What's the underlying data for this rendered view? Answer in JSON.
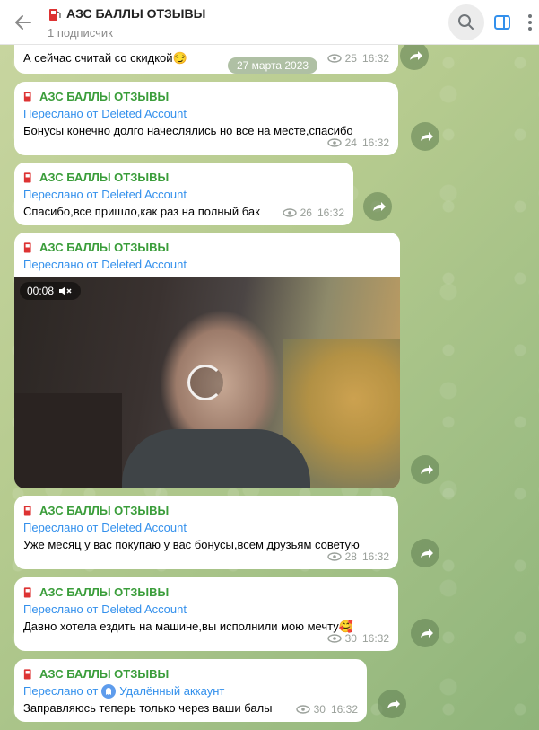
{
  "header": {
    "title": "АЗС БАЛЛЫ ОТЗЫВЫ",
    "subtitle": "1 подписчик"
  },
  "date_divider": "27 марта 2023",
  "messages": [
    {
      "channel": "",
      "forwarded_prefix": "",
      "forwarded_from": "",
      "text": "А сейчас считай со скидкой",
      "emoji": "😏",
      "views": "25",
      "time": "16:32"
    },
    {
      "channel": "АЗС БАЛЛЫ ОТЗЫВЫ",
      "forwarded_prefix": "Переслано от",
      "forwarded_from": "Deleted Account",
      "text": "Бонусы конечно долго начеслялись но все на месте,спасибо",
      "views": "24",
      "time": "16:32"
    },
    {
      "channel": "АЗС БАЛЛЫ ОТЗЫВЫ",
      "forwarded_prefix": "Переслано от",
      "forwarded_from": "Deleted Account",
      "text": "Спасибо,все пришло,как раз на полный бак",
      "views": "26",
      "time": "16:32"
    },
    {
      "channel": "АЗС БАЛЛЫ ОТЗЫВЫ",
      "forwarded_prefix": "Переслано от",
      "forwarded_from": "Deleted Account",
      "video_duration": "00:08"
    },
    {
      "channel": "АЗС БАЛЛЫ ОТЗЫВЫ",
      "forwarded_prefix": "Переслано от",
      "forwarded_from": "Deleted Account",
      "text": "Уже месяц у вас покупаю у вас бонусы,всем друзьям советую",
      "views": "28",
      "time": "16:32"
    },
    {
      "channel": "АЗС БАЛЛЫ ОТЗЫВЫ",
      "forwarded_prefix": "Переслано от",
      "forwarded_from": "Deleted Account",
      "text": "Давно хотела ездить на машине,вы исполнили мою мечту",
      "emoji": "🥰",
      "views": "30",
      "time": "16:32"
    },
    {
      "channel": "АЗС БАЛЛЫ ОТЗЫВЫ",
      "forwarded_prefix": "Переслано от",
      "forwarded_from": "Удалённый аккаунт",
      "text": "Заправляюсь теперь только через ваши балы",
      "views": "30",
      "time": "16:32"
    }
  ],
  "icons": {
    "back": "arrow-left-icon",
    "search": "search-icon",
    "sidebar": "sidebar-toggle-icon",
    "more": "more-vertical-icon",
    "views": "eye-icon",
    "share": "share-arrow-icon",
    "mute": "muted-speaker-icon"
  },
  "colors": {
    "channel_name": "#3a9d3a",
    "forward_link": "#3390ec",
    "meta": "#9aa09a"
  }
}
